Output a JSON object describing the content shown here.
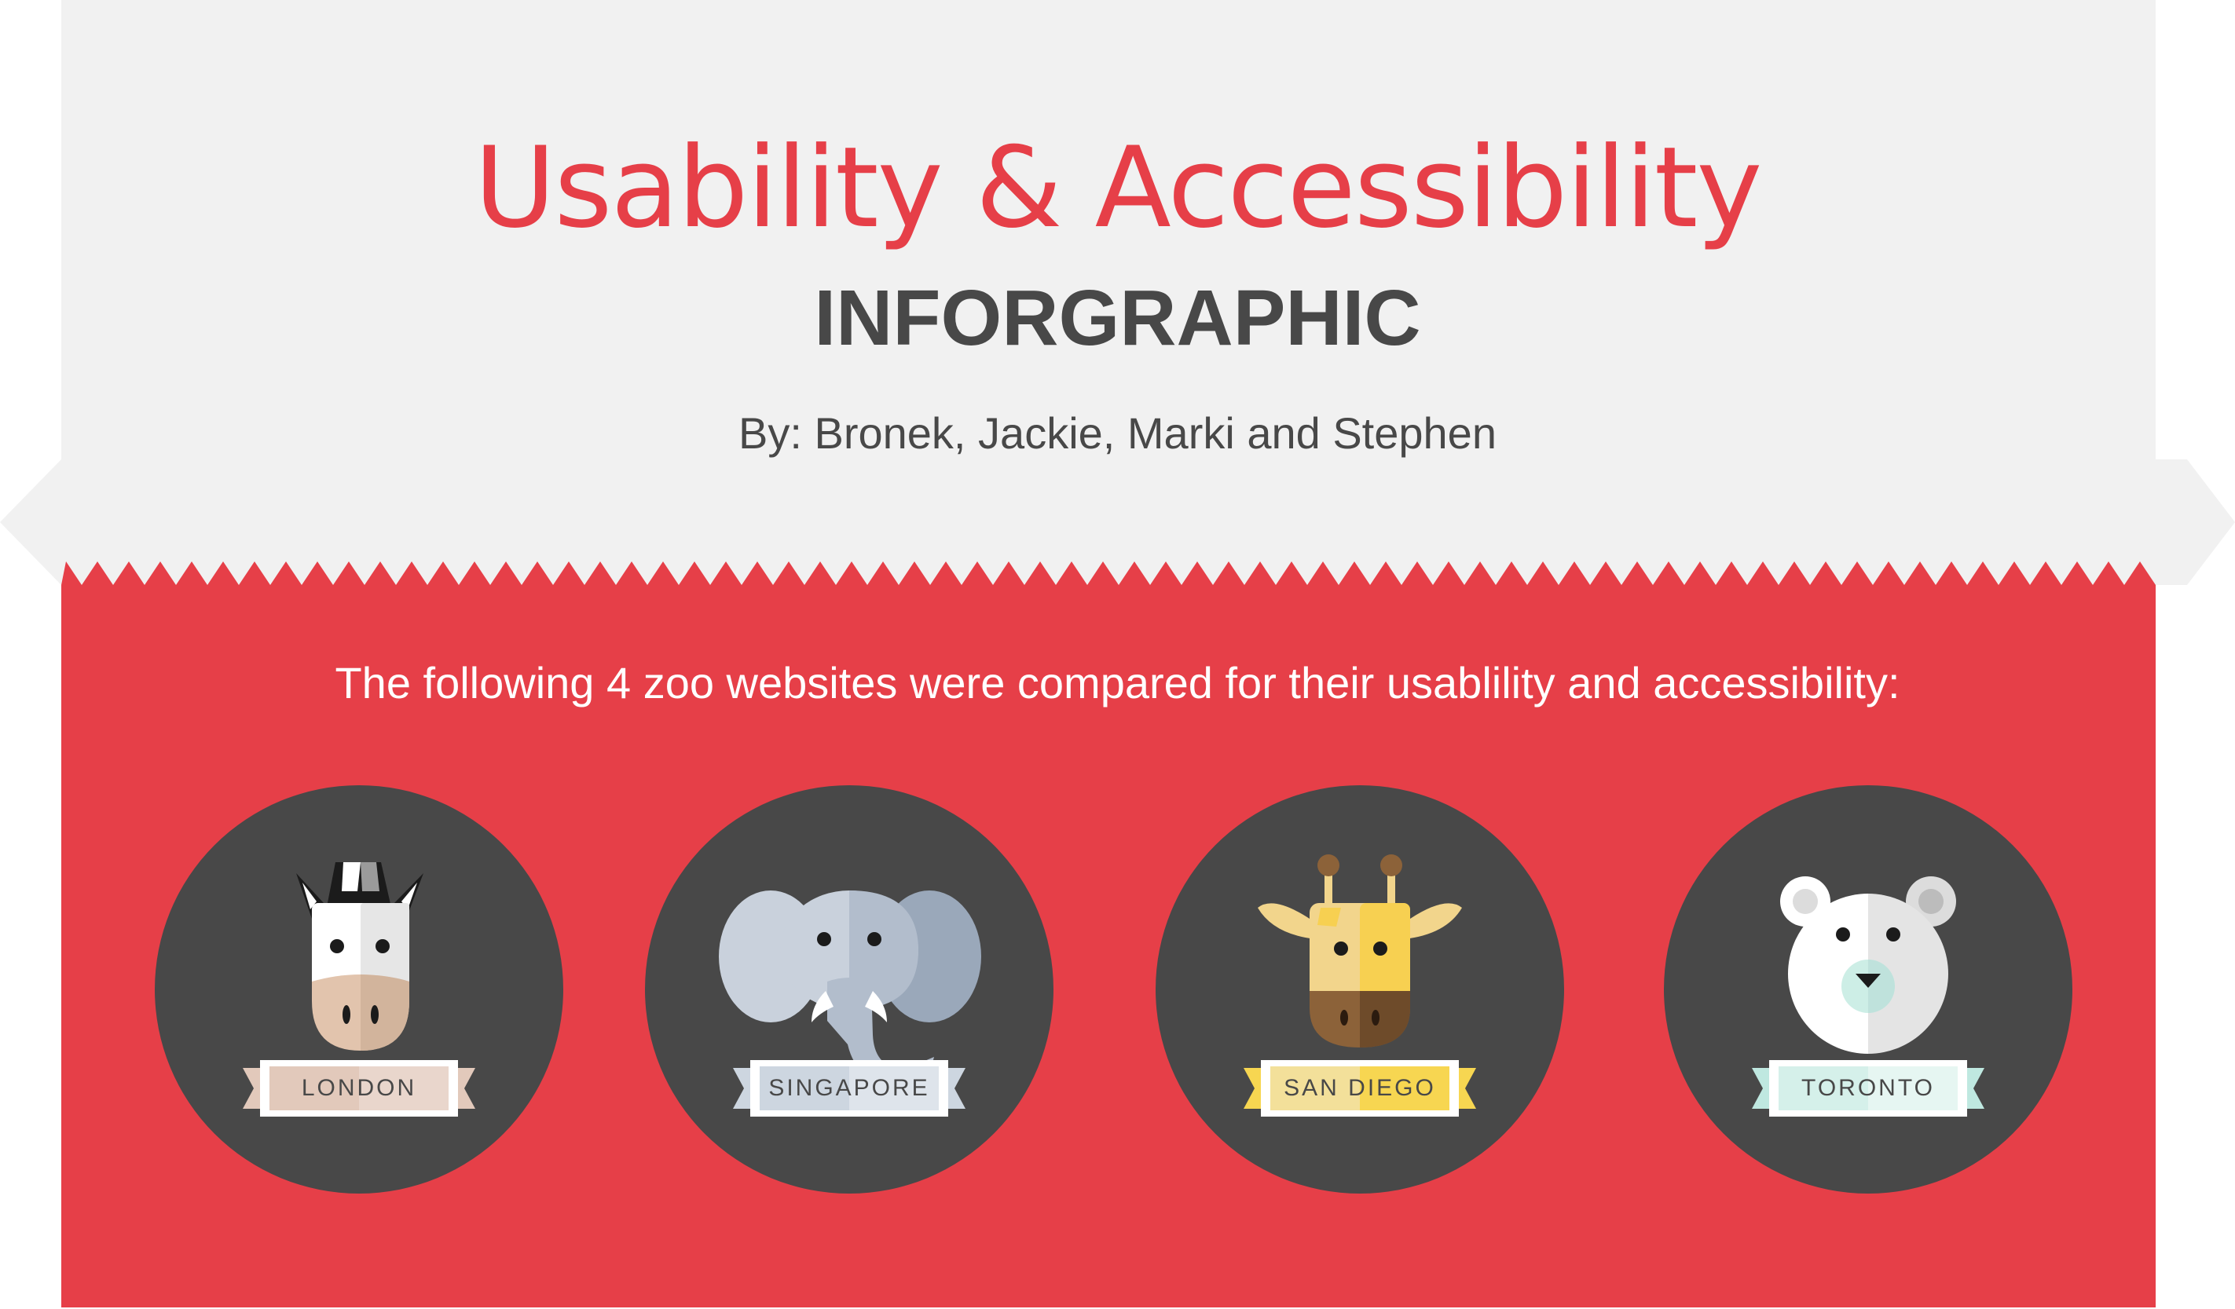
{
  "header": {
    "title": "Usability & Accessibility",
    "subtitle": "INFORGRAPHIC",
    "byline": "By: Bronek, Jackie, Marki and Stephen"
  },
  "intro": "The following 4 zoo websites were compared for their usablility and accessibility:",
  "colors": {
    "accent_red": "#e63f48",
    "header_bg": "#f1f1f1",
    "circle_dark": "#484848",
    "text_dark": "#484848"
  },
  "zoos": [
    {
      "label": "LONDON",
      "animal": "zebra-icon",
      "ribbon_color": "#e2c9bb"
    },
    {
      "label": "SINGAPORE",
      "animal": "elephant-icon",
      "ribbon_color": "#cdd6e0"
    },
    {
      "label": "SAN DIEGO",
      "animal": "giraffe-icon",
      "ribbon_color": "#f7d651"
    },
    {
      "label": "TORONTO",
      "animal": "polar-bear-icon",
      "ribbon_color": "#bfe8e0"
    }
  ]
}
